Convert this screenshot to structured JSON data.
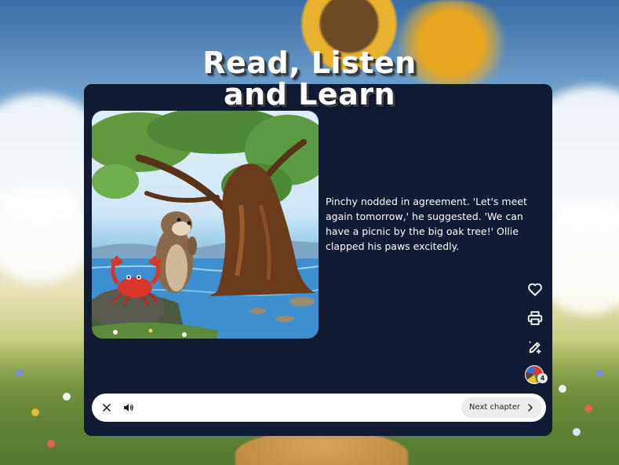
{
  "hero": {
    "title_line1": "Read, Listen",
    "title_line2": "and Learn"
  },
  "story": {
    "paragraph": "Pinchy nodded in agreement. 'Let's meet again tomorrow,' he suggested. 'We can have a picnic by the big oak tree!' Ollie clapped his paws excitedly."
  },
  "side_actions": [
    {
      "icon": "heart-icon"
    },
    {
      "icon": "printer-icon"
    },
    {
      "icon": "pencil-sparkle-icon"
    },
    {
      "icon": "avatar",
      "badge": "4"
    }
  ],
  "player": {
    "close_icon": "close-icon",
    "audio_icon": "speaker-icon",
    "next_label": "Next chapter"
  },
  "colors": {
    "panel": "#111b33",
    "player_bar": "#ffffff",
    "next_button": "#ececec",
    "text": "#ffffff"
  }
}
